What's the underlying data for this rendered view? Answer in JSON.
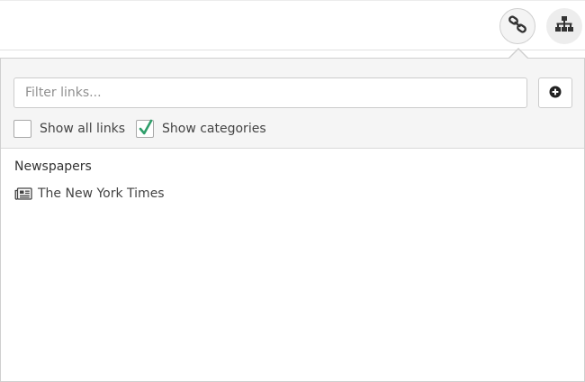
{
  "toolbar": {
    "links_button": {
      "icon": "link-icon",
      "active": true
    },
    "sitemap_button": {
      "icon": "sitemap-icon",
      "active": false
    }
  },
  "links_panel": {
    "filter": {
      "placeholder": "Filter links...",
      "value": ""
    },
    "add_button": {
      "icon": "plus-circle-icon"
    },
    "show_all_links": {
      "label": "Show all links",
      "checked": false
    },
    "show_categories": {
      "label": "Show categories",
      "checked": true,
      "check_color": "#2e9e6a"
    },
    "categories": [
      {
        "title": "Newspapers",
        "links": [
          {
            "icon": "newspaper-icon",
            "label": "The New York Times"
          }
        ]
      }
    ]
  }
}
